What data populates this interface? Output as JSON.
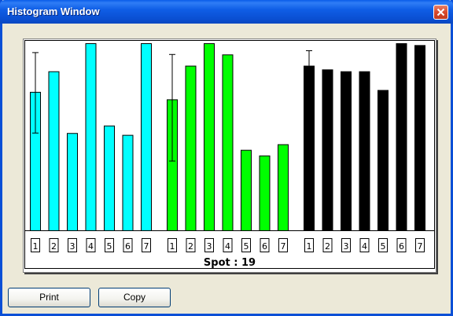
{
  "window": {
    "title": "Histogram Window"
  },
  "chart_data": {
    "type": "bar",
    "title": "Spot : 19",
    "ylim": [
      0,
      100
    ],
    "groups": [
      {
        "color": "#00ffff",
        "categories": [
          "1",
          "2",
          "3",
          "4",
          "5",
          "6",
          "7"
        ],
        "values": [
          74,
          85,
          52,
          100,
          56,
          51,
          100
        ],
        "error_bar": {
          "category": "1",
          "low": 52,
          "high": 95
        }
      },
      {
        "color": "#00ff00",
        "categories": [
          "1",
          "2",
          "3",
          "4",
          "5",
          "6",
          "7"
        ],
        "values": [
          70,
          88,
          100,
          94,
          43,
          40,
          46
        ],
        "error_bar": {
          "category": "1",
          "low": 37,
          "high": 94
        }
      },
      {
        "color": "#000000",
        "categories": [
          "1",
          "2",
          "3",
          "4",
          "5",
          "6",
          "7"
        ],
        "values": [
          88,
          86,
          85,
          85,
          75,
          100,
          99
        ],
        "error_bar": {
          "category": "1",
          "low": 88,
          "high": 96
        }
      }
    ]
  },
  "buttons": {
    "print_label": "Print",
    "copy_label": "Copy"
  }
}
